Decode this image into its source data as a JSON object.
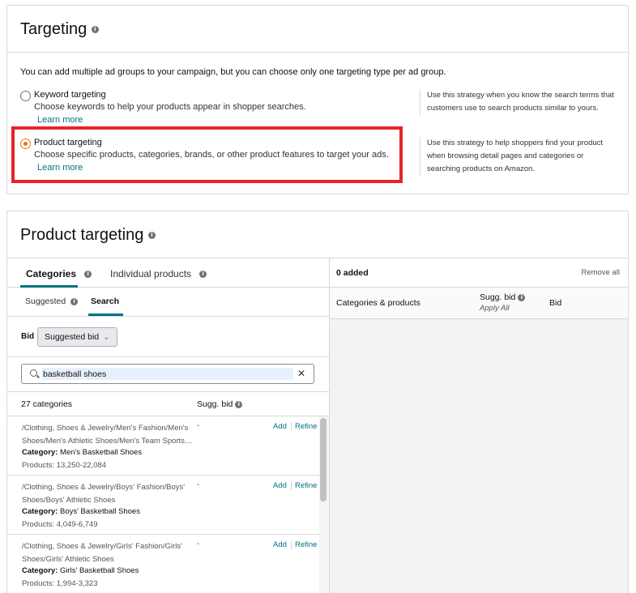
{
  "targeting": {
    "title": "Targeting",
    "intro": "You can add multiple ad groups to your campaign, but you can choose only one targeting type per ad group.",
    "options": [
      {
        "label": "Keyword targeting",
        "description": "Choose keywords to help your products appear in shopper searches.",
        "learn_more": "Learn more",
        "side": "Use this strategy when you know the search terms that customers use to search products similar to yours.",
        "selected": false
      },
      {
        "label": "Product targeting",
        "description": "Choose specific products, categories, brands, or other product features to target your ads.",
        "learn_more": "Learn more",
        "side": "Use this strategy to help shoppers find your product when browsing detail pages and categories or searching products on Amazon.",
        "selected": true
      }
    ]
  },
  "product_targeting": {
    "title": "Product targeting",
    "tabs": [
      "Categories",
      "Individual products"
    ],
    "subtabs": [
      "Suggested",
      "Search"
    ],
    "bid": {
      "label": "Bid",
      "value": "Suggested bid"
    },
    "search": {
      "value": "basketball shoes"
    },
    "list_header": {
      "count": "27 categories",
      "sugg_bid": "Sugg. bid"
    },
    "rows": [
      {
        "path": "/Clothing, Shoes & Jewelry/Men's Fashion/Men's Shoes/Men's Athletic Shoes/Men's Team Sports…",
        "category_label": "Category:",
        "category": "Men's Basketball Shoes",
        "products": "Products: 13,250-22,084",
        "bid": "-",
        "add": "Add",
        "refine": "Refine"
      },
      {
        "path": "/Clothing, Shoes & Jewelry/Boys' Fashion/Boys' Shoes/Boys' Athletic Shoes",
        "category_label": "Category:",
        "category": "Boys' Basketball Shoes",
        "products": "Products: 4,049-6,749",
        "bid": "-",
        "add": "Add",
        "refine": "Refine"
      },
      {
        "path": "/Clothing, Shoes & Jewelry/Girls' Fashion/Girls' Shoes/Girls' Athletic Shoes",
        "category_label": "Category:",
        "category": "Girls' Basketball Shoes",
        "products": "Products: 1,994-3,323",
        "bid": "-",
        "add": "Add",
        "refine": "Refine"
      }
    ],
    "added": {
      "count": "0 added",
      "remove_all": "Remove all",
      "col_categories": "Categories & products",
      "col_sugg": "Sugg. bid",
      "col_apply": "Apply All",
      "col_bid": "Bid"
    }
  },
  "icons": {
    "info": "info-icon",
    "search": "search-icon",
    "clear": "close-icon",
    "select": "chevron-down-icon"
  },
  "colors": {
    "accent": "#007185",
    "radio_selected": "#e47911",
    "highlight": "#e3262b"
  }
}
